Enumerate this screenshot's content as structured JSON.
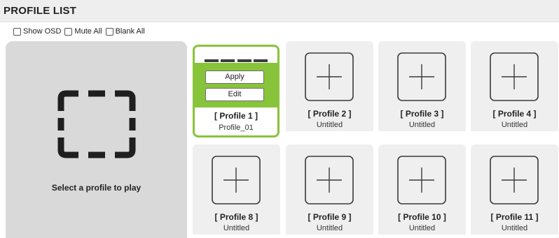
{
  "header": {
    "title": "PROFILE LIST"
  },
  "options": [
    {
      "label": "Show OSD",
      "checked": false
    },
    {
      "label": "Mute All",
      "checked": false
    },
    {
      "label": "Blank All",
      "checked": false
    }
  ],
  "preview": {
    "label": "Select a profile to play",
    "icon": "empty-frame-icon"
  },
  "active_profile": {
    "name": "[ Profile 1 ]",
    "subtitle": "Profile_01",
    "apply_label": "Apply",
    "edit_label": "Edit",
    "accent_color": "#88c43a"
  },
  "profiles": [
    {
      "name": "[ Profile 2 ]",
      "subtitle": "Untitled"
    },
    {
      "name": "[ Profile 3 ]",
      "subtitle": "Untitled"
    },
    {
      "name": "[ Profile 4 ]",
      "subtitle": "Untitled"
    },
    {
      "name": "[ Profile 8 ]",
      "subtitle": "Untitled"
    },
    {
      "name": "[ Profile 9 ]",
      "subtitle": "Untitled"
    },
    {
      "name": "[ Profile 10 ]",
      "subtitle": "Untitled"
    },
    {
      "name": "[ Profile 11 ]",
      "subtitle": "Untitled"
    }
  ],
  "add_icon": "plus-box-icon"
}
